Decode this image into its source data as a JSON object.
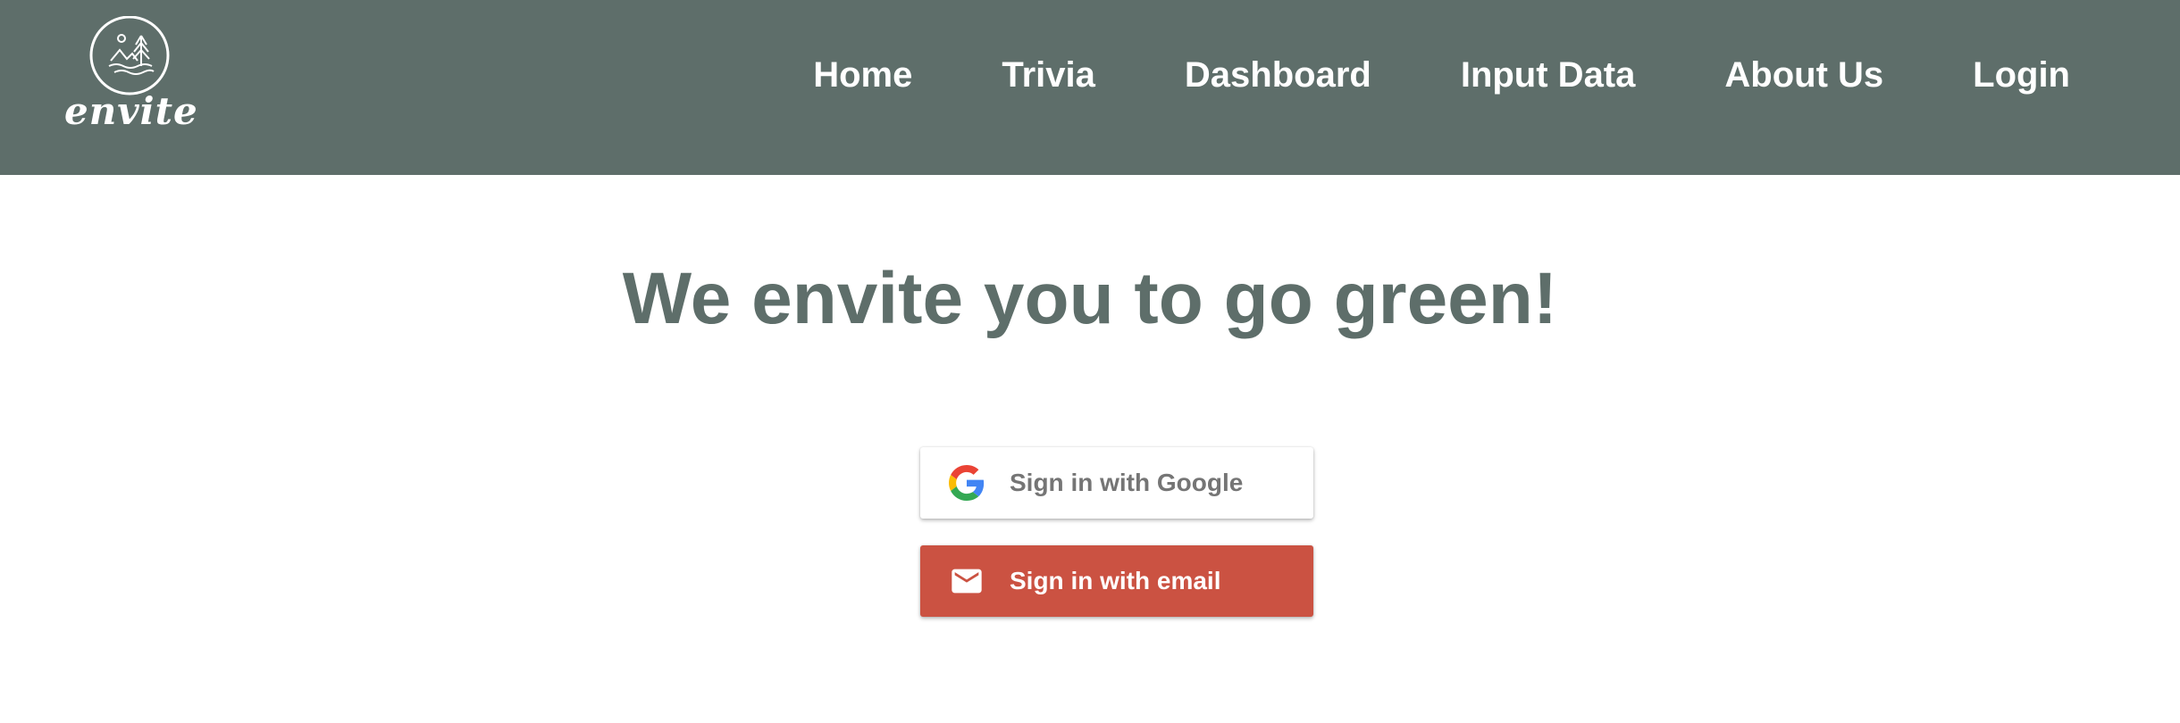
{
  "brand": {
    "name": "envite",
    "logo_icon": "envite-logo-icon"
  },
  "nav": {
    "items": [
      {
        "label": "Home"
      },
      {
        "label": "Trivia"
      },
      {
        "label": "Dashboard"
      },
      {
        "label": "Input Data"
      },
      {
        "label": "About Us"
      },
      {
        "label": "Login"
      }
    ]
  },
  "hero": {
    "title": "We envite you to go green!"
  },
  "auth": {
    "google": {
      "label": "Sign in with Google",
      "icon": "google-icon"
    },
    "email": {
      "label": "Sign in with email",
      "icon": "mail-icon"
    }
  },
  "colors": {
    "navbar_bg": "#5e6e6a",
    "hero_text": "#5e6e6a",
    "email_button": "#cb5242",
    "google_label": "#757575"
  }
}
